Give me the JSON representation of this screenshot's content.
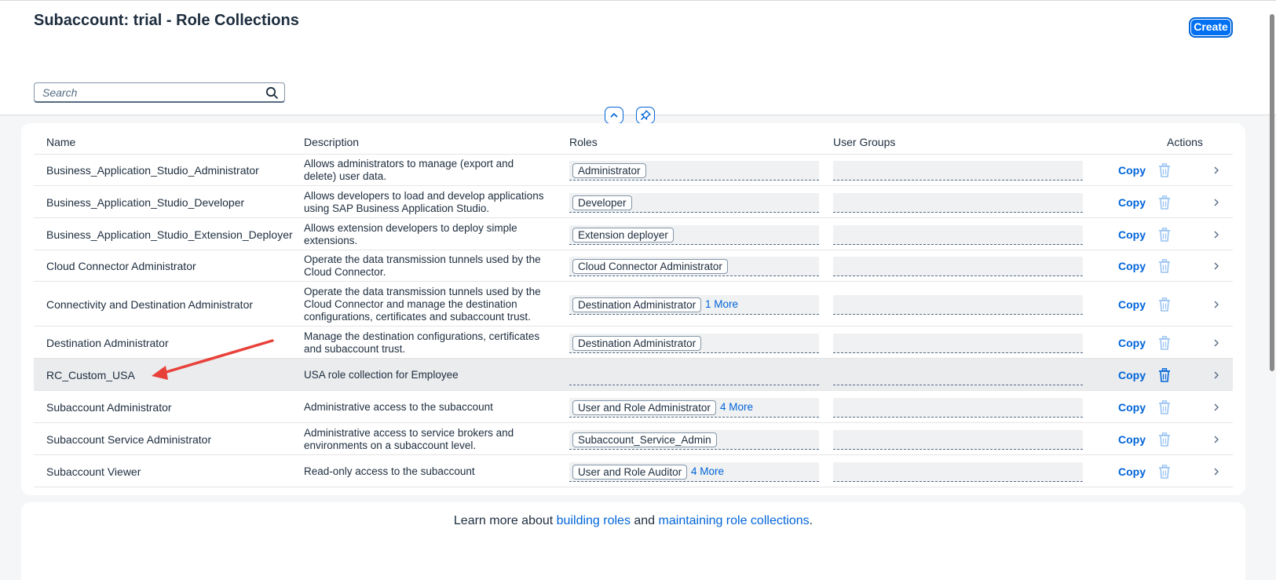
{
  "page": {
    "title": "Subaccount: trial - Role Collections",
    "create_label": "Create",
    "search_placeholder": "Search"
  },
  "table": {
    "columns": [
      "Name",
      "Description",
      "Roles",
      "User Groups",
      "Actions"
    ],
    "copy_label": "Copy",
    "rows": [
      {
        "name": "Business_Application_Studio_Administrator",
        "desc1": "Allows administrators to manage (export and",
        "desc2": "delete) user data.",
        "role": "Administrator",
        "more": ""
      },
      {
        "name": "Business_Application_Studio_Developer",
        "desc1": "Allows developers to load and develop applications",
        "desc2": "using SAP Business Application Studio.",
        "role": "Developer",
        "more": ""
      },
      {
        "name": "Business_Application_Studio_Extension_Deployer",
        "desc1": "Allows extension developers to deploy simple",
        "desc2": "extensions.",
        "role": "Extension deployer",
        "more": ""
      },
      {
        "name": "Cloud Connector Administrator",
        "desc1": "Operate the data transmission tunnels used by the",
        "desc2": "Cloud Connector.",
        "role": "Cloud Connector Administrator",
        "more": ""
      },
      {
        "name": "Connectivity and Destination Administrator",
        "desc1": "Operate the data transmission tunnels used by the",
        "desc2": "Cloud Connector and manage the destination",
        "desc3": "configurations, certificates and subaccount trust.",
        "role": "Destination Administrator",
        "more": "1 More"
      },
      {
        "name": "Destination Administrator",
        "desc1": "Manage the destination configurations, certificates",
        "desc2": "and subaccount trust.",
        "role": "Destination Administrator",
        "more": ""
      },
      {
        "name": "RC_Custom_USA",
        "desc1": "USA role collection for Employee",
        "desc2": "",
        "role": "",
        "more": ""
      },
      {
        "name": "Subaccount Administrator",
        "desc1": "Administrative access to the subaccount",
        "desc2": "",
        "role": "User and Role Administrator",
        "more": "4 More"
      },
      {
        "name": "Subaccount Service Administrator",
        "desc1": "Administrative access to service brokers and",
        "desc2": "environments on a subaccount level.",
        "role": "Subaccount_Service_Admin",
        "more": ""
      },
      {
        "name": "Subaccount Viewer",
        "desc1": "Read-only access to the subaccount",
        "desc2": "",
        "role": "User and Role Auditor",
        "more": "4 More"
      }
    ]
  },
  "footer": {
    "prefix": "Learn more about ",
    "link1": "building roles",
    "middle": " and ",
    "link2": "maintaining role collections",
    "suffix": "."
  },
  "icons": {
    "search": "search-icon",
    "collapse": "chevron-up-icon",
    "pin": "pin-icon",
    "delete": "trash-icon",
    "navigate": "chevron-right-icon",
    "annotation": "red-arrow"
  },
  "colors": {
    "accent": "#0064d9",
    "annotation": "#e8413a"
  }
}
